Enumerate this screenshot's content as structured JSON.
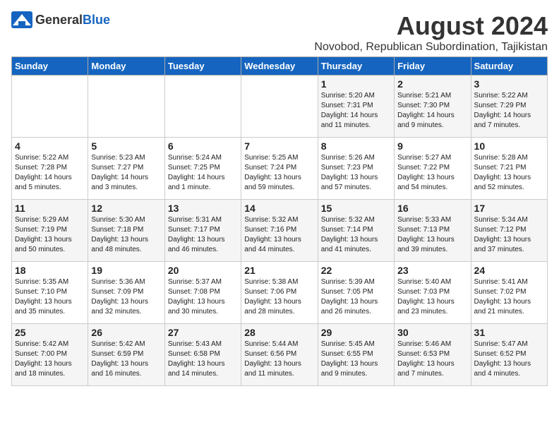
{
  "header": {
    "logo_general": "General",
    "logo_blue": "Blue",
    "month_year": "August 2024",
    "location": "Novobod, Republican Subordination, Tajikistan"
  },
  "weekdays": [
    "Sunday",
    "Monday",
    "Tuesday",
    "Wednesday",
    "Thursday",
    "Friday",
    "Saturday"
  ],
  "weeks": [
    [
      {
        "day": "",
        "info": ""
      },
      {
        "day": "",
        "info": ""
      },
      {
        "day": "",
        "info": ""
      },
      {
        "day": "",
        "info": ""
      },
      {
        "day": "1",
        "info": "Sunrise: 5:20 AM\nSunset: 7:31 PM\nDaylight: 14 hours\nand 11 minutes."
      },
      {
        "day": "2",
        "info": "Sunrise: 5:21 AM\nSunset: 7:30 PM\nDaylight: 14 hours\nand 9 minutes."
      },
      {
        "day": "3",
        "info": "Sunrise: 5:22 AM\nSunset: 7:29 PM\nDaylight: 14 hours\nand 7 minutes."
      }
    ],
    [
      {
        "day": "4",
        "info": "Sunrise: 5:22 AM\nSunset: 7:28 PM\nDaylight: 14 hours\nand 5 minutes."
      },
      {
        "day": "5",
        "info": "Sunrise: 5:23 AM\nSunset: 7:27 PM\nDaylight: 14 hours\nand 3 minutes."
      },
      {
        "day": "6",
        "info": "Sunrise: 5:24 AM\nSunset: 7:25 PM\nDaylight: 14 hours\nand 1 minute."
      },
      {
        "day": "7",
        "info": "Sunrise: 5:25 AM\nSunset: 7:24 PM\nDaylight: 13 hours\nand 59 minutes."
      },
      {
        "day": "8",
        "info": "Sunrise: 5:26 AM\nSunset: 7:23 PM\nDaylight: 13 hours\nand 57 minutes."
      },
      {
        "day": "9",
        "info": "Sunrise: 5:27 AM\nSunset: 7:22 PM\nDaylight: 13 hours\nand 54 minutes."
      },
      {
        "day": "10",
        "info": "Sunrise: 5:28 AM\nSunset: 7:21 PM\nDaylight: 13 hours\nand 52 minutes."
      }
    ],
    [
      {
        "day": "11",
        "info": "Sunrise: 5:29 AM\nSunset: 7:19 PM\nDaylight: 13 hours\nand 50 minutes."
      },
      {
        "day": "12",
        "info": "Sunrise: 5:30 AM\nSunset: 7:18 PM\nDaylight: 13 hours\nand 48 minutes."
      },
      {
        "day": "13",
        "info": "Sunrise: 5:31 AM\nSunset: 7:17 PM\nDaylight: 13 hours\nand 46 minutes."
      },
      {
        "day": "14",
        "info": "Sunrise: 5:32 AM\nSunset: 7:16 PM\nDaylight: 13 hours\nand 44 minutes."
      },
      {
        "day": "15",
        "info": "Sunrise: 5:32 AM\nSunset: 7:14 PM\nDaylight: 13 hours\nand 41 minutes."
      },
      {
        "day": "16",
        "info": "Sunrise: 5:33 AM\nSunset: 7:13 PM\nDaylight: 13 hours\nand 39 minutes."
      },
      {
        "day": "17",
        "info": "Sunrise: 5:34 AM\nSunset: 7:12 PM\nDaylight: 13 hours\nand 37 minutes."
      }
    ],
    [
      {
        "day": "18",
        "info": "Sunrise: 5:35 AM\nSunset: 7:10 PM\nDaylight: 13 hours\nand 35 minutes."
      },
      {
        "day": "19",
        "info": "Sunrise: 5:36 AM\nSunset: 7:09 PM\nDaylight: 13 hours\nand 32 minutes."
      },
      {
        "day": "20",
        "info": "Sunrise: 5:37 AM\nSunset: 7:08 PM\nDaylight: 13 hours\nand 30 minutes."
      },
      {
        "day": "21",
        "info": "Sunrise: 5:38 AM\nSunset: 7:06 PM\nDaylight: 13 hours\nand 28 minutes."
      },
      {
        "day": "22",
        "info": "Sunrise: 5:39 AM\nSunset: 7:05 PM\nDaylight: 13 hours\nand 26 minutes."
      },
      {
        "day": "23",
        "info": "Sunrise: 5:40 AM\nSunset: 7:03 PM\nDaylight: 13 hours\nand 23 minutes."
      },
      {
        "day": "24",
        "info": "Sunrise: 5:41 AM\nSunset: 7:02 PM\nDaylight: 13 hours\nand 21 minutes."
      }
    ],
    [
      {
        "day": "25",
        "info": "Sunrise: 5:42 AM\nSunset: 7:00 PM\nDaylight: 13 hours\nand 18 minutes."
      },
      {
        "day": "26",
        "info": "Sunrise: 5:42 AM\nSunset: 6:59 PM\nDaylight: 13 hours\nand 16 minutes."
      },
      {
        "day": "27",
        "info": "Sunrise: 5:43 AM\nSunset: 6:58 PM\nDaylight: 13 hours\nand 14 minutes."
      },
      {
        "day": "28",
        "info": "Sunrise: 5:44 AM\nSunset: 6:56 PM\nDaylight: 13 hours\nand 11 minutes."
      },
      {
        "day": "29",
        "info": "Sunrise: 5:45 AM\nSunset: 6:55 PM\nDaylight: 13 hours\nand 9 minutes."
      },
      {
        "day": "30",
        "info": "Sunrise: 5:46 AM\nSunset: 6:53 PM\nDaylight: 13 hours\nand 7 minutes."
      },
      {
        "day": "31",
        "info": "Sunrise: 5:47 AM\nSunset: 6:52 PM\nDaylight: 13 hours\nand 4 minutes."
      }
    ]
  ]
}
